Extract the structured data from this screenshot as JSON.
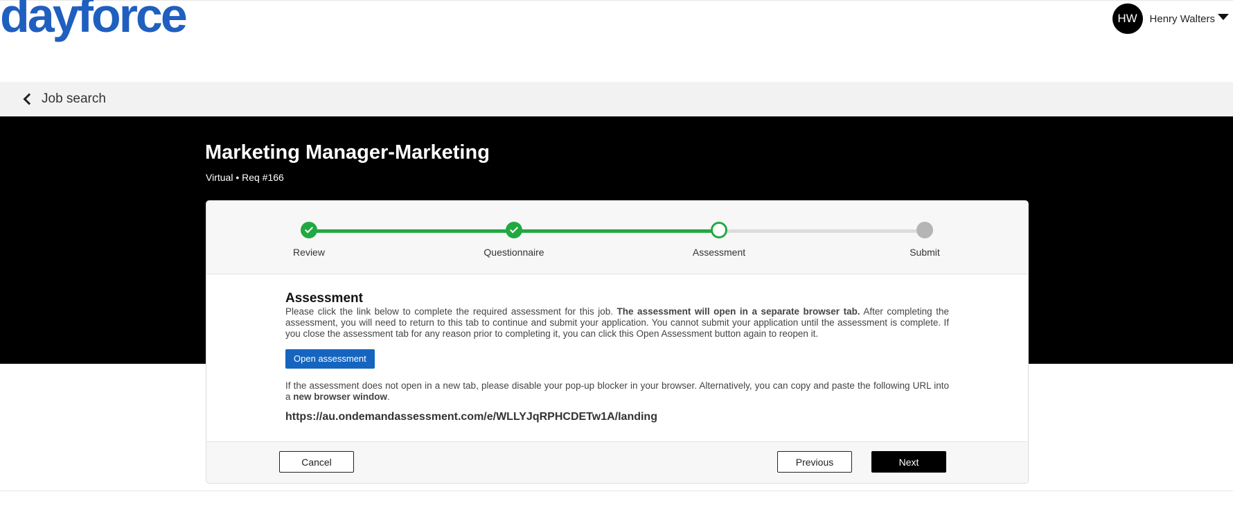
{
  "header": {
    "logo_text": "dayforce",
    "user": {
      "initials": "HW",
      "name": "Henry Walters"
    }
  },
  "breadcrumb": {
    "back_label": "Job search"
  },
  "job": {
    "title": "Marketing Manager-Marketing",
    "meta": "Virtual • Req #166"
  },
  "stepper": {
    "steps": [
      {
        "label": "Review",
        "status": "complete"
      },
      {
        "label": "Questionnaire",
        "status": "complete"
      },
      {
        "label": "Assessment",
        "status": "current"
      },
      {
        "label": "Submit",
        "status": "pending"
      }
    ]
  },
  "assessment": {
    "title": "Assessment",
    "intro_before_bold": "Please click the link below to complete the required assessment for this job. ",
    "intro_bold": "The assessment will open in a separate browser tab.",
    "intro_after_bold": " After completing the assessment, you will need to return to this tab to continue and submit your application. You cannot submit your application until the assessment is complete. If you close the assessment tab for any reason prior to completing it, you can click this Open Assessment button again to reopen it.",
    "open_button": "Open assessment",
    "popup_before_bold": "If the assessment does not open in a new tab, please disable your pop-up blocker in your browser. Alternatively, you can copy and paste the following URL into a ",
    "popup_bold": "new browser window",
    "popup_after_bold": ".",
    "url": "https://au.ondemandassessment.com/e/WLLYJqRPHCDETw1A/landing"
  },
  "footer": {
    "cancel": "Cancel",
    "previous": "Previous",
    "next": "Next"
  },
  "colors": {
    "brand": "#1f5fbf",
    "step_complete": "#22a843",
    "step_pending": "#b5b5b5",
    "primary_button": "#1565c0"
  }
}
